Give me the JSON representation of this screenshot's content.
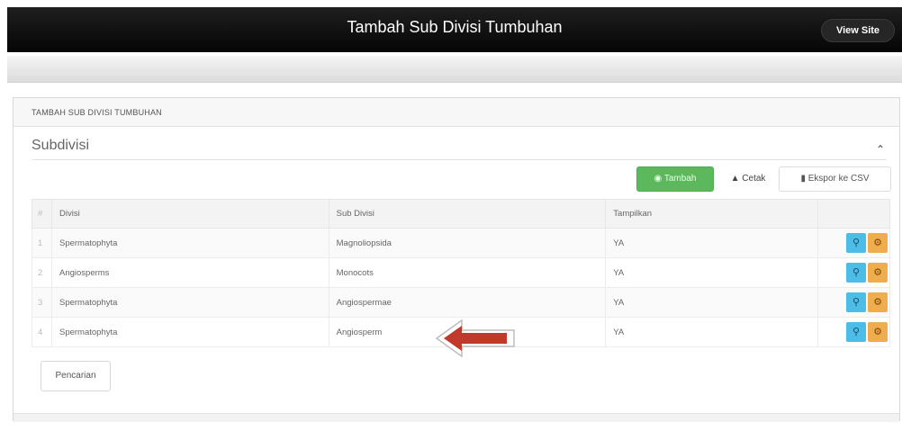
{
  "header": {
    "title": "Tambah Sub Divisi Tumbuhan",
    "view_site": "View Site"
  },
  "breadcrumb": "TAMBAH SUB DIVISI TUMBUHAN",
  "section": {
    "title": "Subdivisi",
    "collapse_icon": "chevron-up-icon"
  },
  "toolbar": {
    "tambah": "Tambah",
    "cetak": "Cetak",
    "export": "Ekspor ke CSV"
  },
  "table": {
    "headers": [
      "#",
      "Divisi",
      "Sub Divisi",
      "Tampilkan"
    ],
    "rows": [
      {
        "num": "1",
        "divisi": "Spermatophyta",
        "sub": "Magnoliopsida",
        "tampil": "YA"
      },
      {
        "num": "2",
        "divisi": "Angiosperms",
        "sub": "Monocots",
        "tampil": "YA"
      },
      {
        "num": "3",
        "divisi": "Spermatophyta",
        "sub": "Angiospermae",
        "tampil": "YA"
      },
      {
        "num": "4",
        "divisi": "Spermatophyta",
        "sub": "Angiosperm",
        "tampil": "YA"
      }
    ]
  },
  "search_button": "Pencarian",
  "colors": {
    "green": "#5cb85c",
    "blue": "#4bbde6",
    "orange": "#f0ad4e",
    "arrow": "#c0392b"
  }
}
